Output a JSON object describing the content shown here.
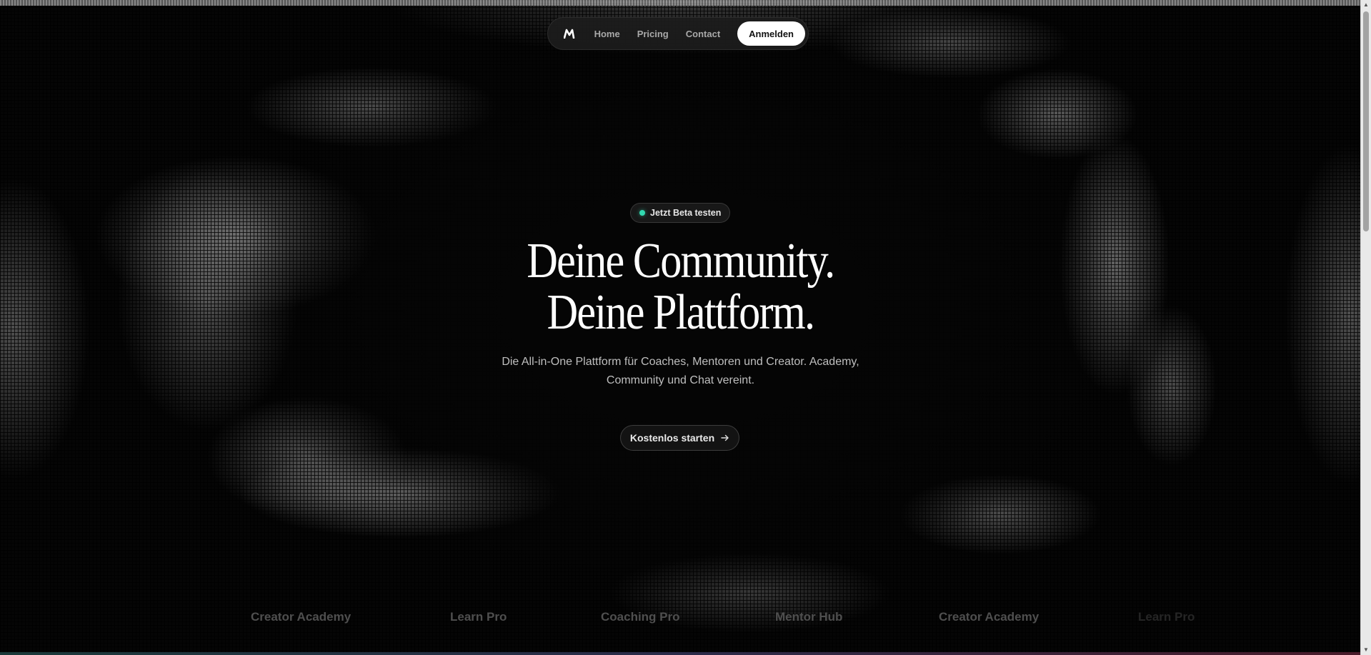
{
  "nav": {
    "logo_icon": "brand-m-logo-icon",
    "links": [
      {
        "label": "Home"
      },
      {
        "label": "Pricing"
      },
      {
        "label": "Contact"
      }
    ],
    "cta_label": "Anmelden"
  },
  "hero": {
    "badge": {
      "label": "Jetzt Beta testen",
      "dot_color": "#32d9b0"
    },
    "headline_line1": "Deine Community.",
    "headline_line2": "Deine Plattform.",
    "subline_line1": "Die All-in-One Plattform für Coaches, Mentoren und Creator. Academy,",
    "subline_line2": "Community und Chat vereint.",
    "cta_label": "Kostenlos starten",
    "cta_icon": "arrow-right-icon"
  },
  "logos": [
    {
      "label": "Creator Academy"
    },
    {
      "label": "Learn Pro"
    },
    {
      "label": "Coaching Pro"
    },
    {
      "label": "Mentor Hub"
    },
    {
      "label": "Creator Academy"
    },
    {
      "label": "Learn Pro"
    }
  ],
  "colors": {
    "background": "#050505",
    "accent": "#32d9b0",
    "button_primary": "#ffffff"
  }
}
